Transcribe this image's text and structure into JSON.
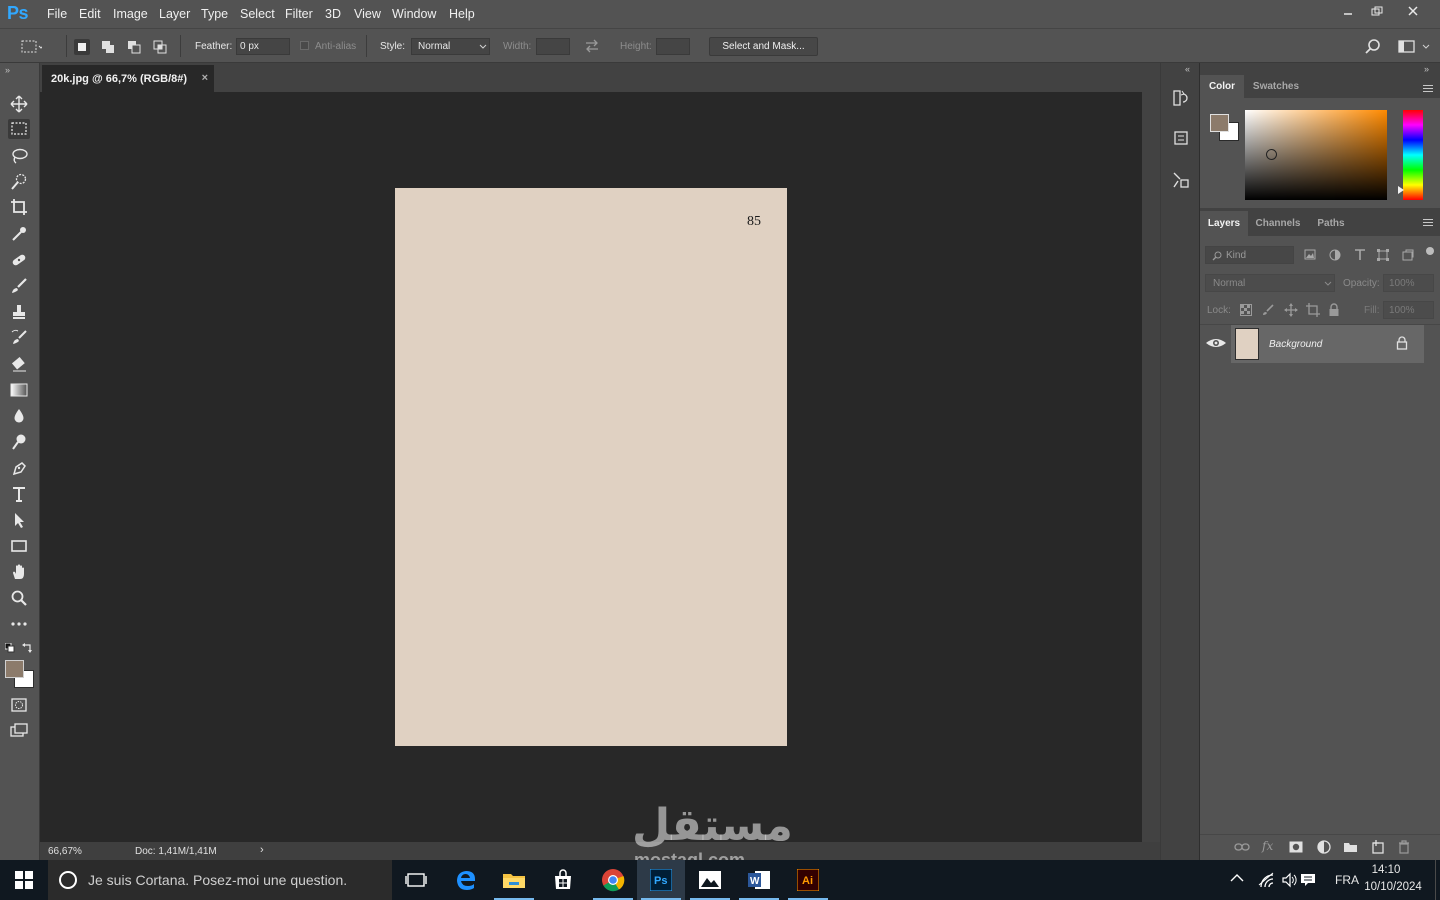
{
  "app": {
    "logo": "Ps"
  },
  "menu": [
    "File",
    "Edit",
    "Image",
    "Layer",
    "Type",
    "Select",
    "Filter",
    "3D",
    "View",
    "Window",
    "Help"
  ],
  "options": {
    "feather_label": "Feather:",
    "feather_value": "0 px",
    "antialias_label": "Anti-alias",
    "style_label": "Style:",
    "style_value": "Normal",
    "width_label": "Width:",
    "height_label": "Height:",
    "select_mask_label": "Select and Mask..."
  },
  "document": {
    "tab_title": "20k.jpg @ 66,7% (RGB/8#)",
    "close_glyph": "×",
    "page_number": "85",
    "page_color": "#e0d1c2"
  },
  "status": {
    "zoom": "66,67%",
    "doc_size": "Doc: 1,41M/1,41M",
    "arrow": "›"
  },
  "color_panel": {
    "tabs": [
      "Color",
      "Swatches"
    ],
    "foreground": "#8c7b6b",
    "background": "#ffffff"
  },
  "layers_panel": {
    "tabs": [
      "Layers",
      "Channels",
      "Paths"
    ],
    "filter_placeholder": "Kind",
    "blend_mode": "Normal",
    "opacity_label": "Opacity:",
    "opacity_value": "100%",
    "lock_label": "Lock:",
    "fill_label": "Fill:",
    "fill_value": "100%",
    "layers": [
      {
        "name": "Background",
        "thumb_color": "#e0d1c2"
      }
    ]
  },
  "taskbar": {
    "cortana_placeholder": "Je suis Cortana. Posez-moi une question.",
    "language": "FRA",
    "time": "14:10",
    "date": "10/10/2024"
  },
  "watermark": {
    "text": "مستقل",
    "sub": "mostaql.com"
  }
}
